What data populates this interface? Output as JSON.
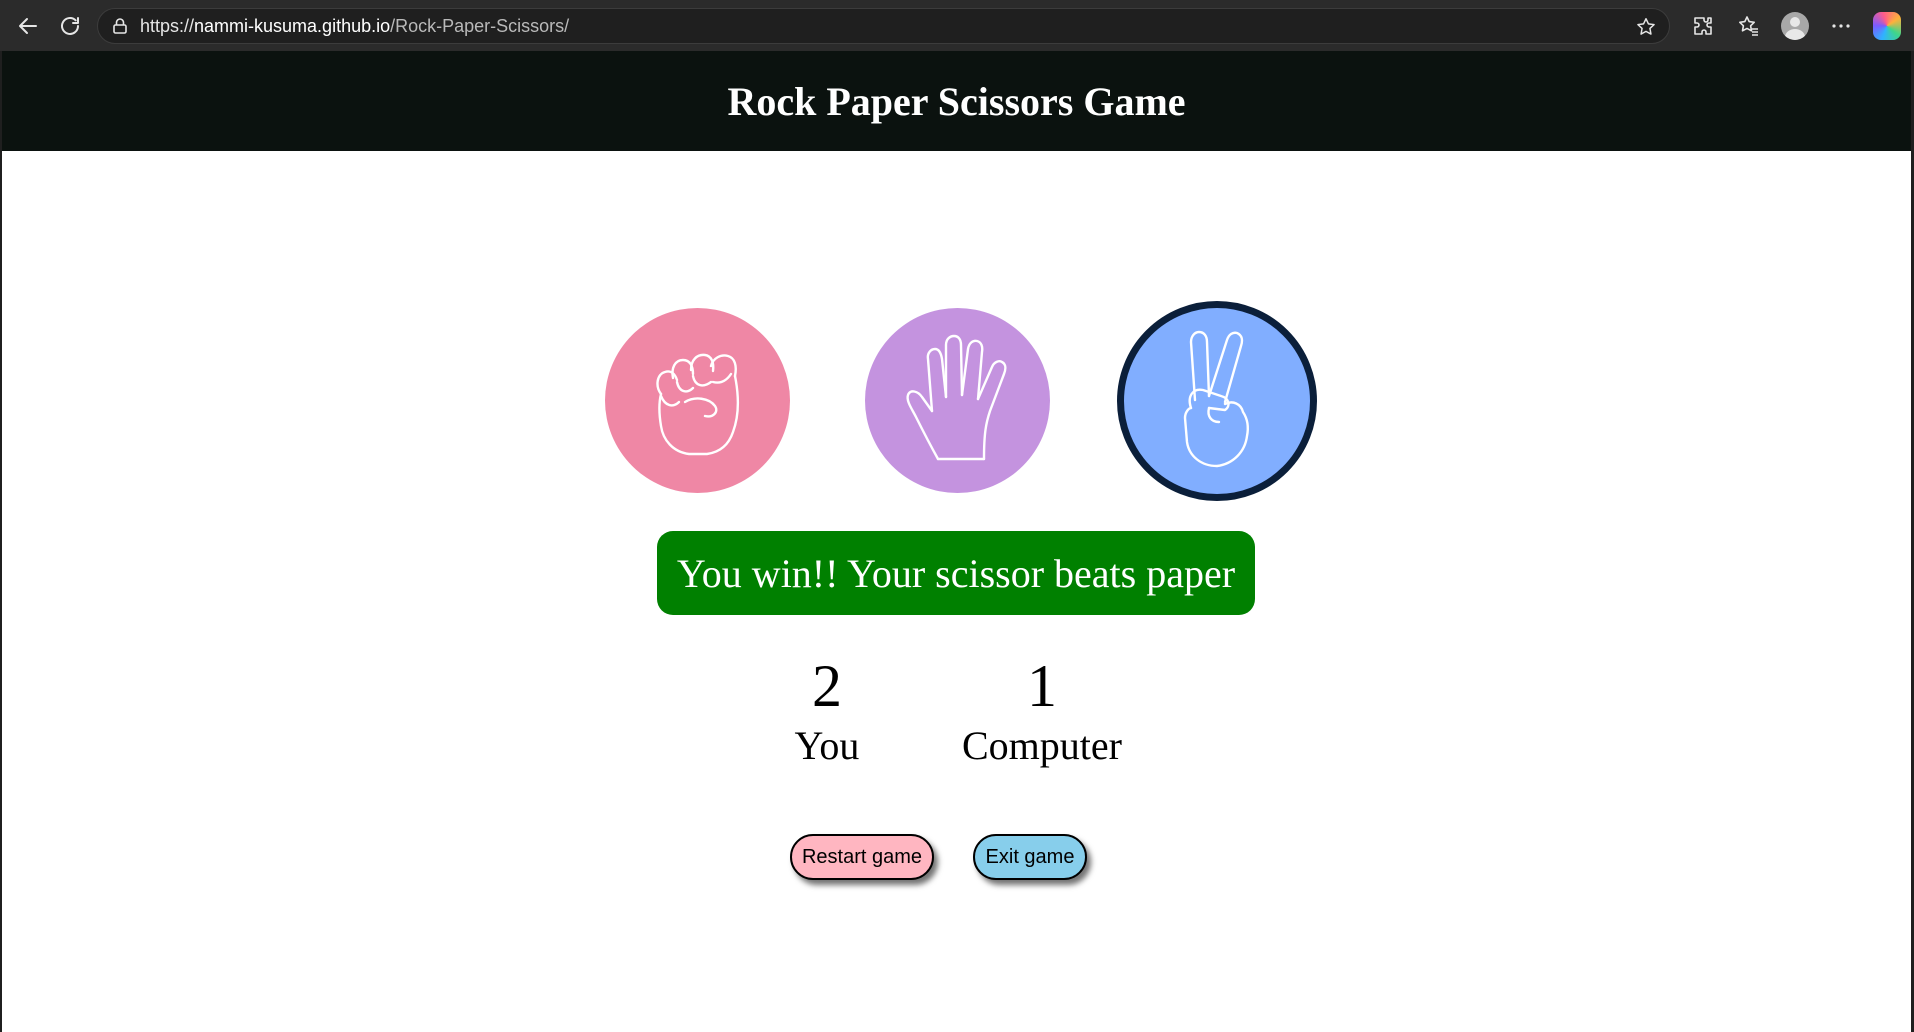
{
  "browser": {
    "url_scheme": "https://",
    "url_host": "nammi-kusuma.github.io",
    "url_path": "/Rock-Paper-Scissors/"
  },
  "header": {
    "title": "Rock Paper Scissors Game"
  },
  "choices": [
    {
      "name": "rock",
      "icon": "fist-icon",
      "color": "#ef87a5",
      "selected": false
    },
    {
      "name": "paper",
      "icon": "open-hand-icon",
      "color": "#c493df",
      "selected": false
    },
    {
      "name": "scissors",
      "icon": "peace-sign-icon",
      "color": "#81aeff",
      "selected": true
    }
  ],
  "result": {
    "message": "You win!! Your scissor beats paper",
    "color": "#008000"
  },
  "score": {
    "user": {
      "value": "2",
      "label": "You"
    },
    "computer": {
      "value": "1",
      "label": "Computer"
    }
  },
  "buttons": {
    "restart_label": "Restart game",
    "restart_color": "#ffb6c1",
    "exit_label": "Exit game",
    "exit_color": "#87ceeb"
  }
}
